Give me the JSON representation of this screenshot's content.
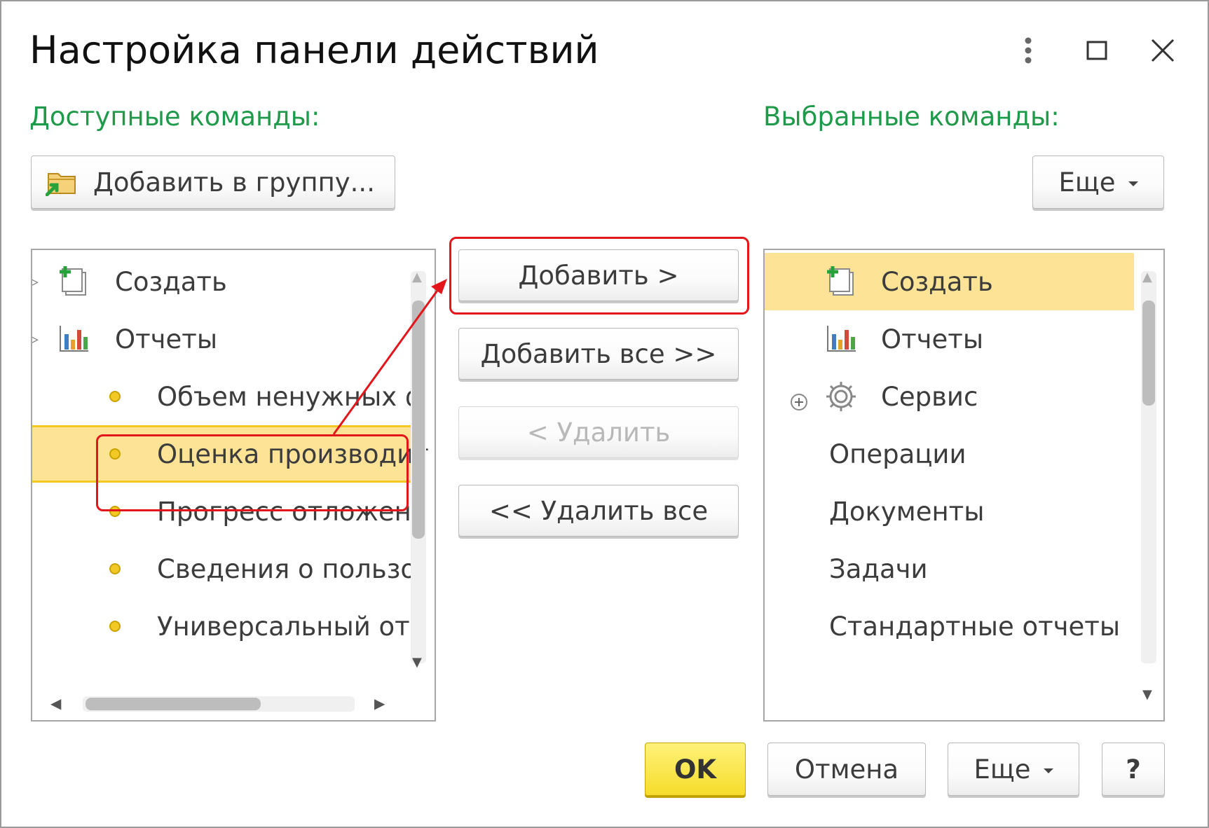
{
  "window": {
    "title": "Настройка панели действий",
    "controls": [
      "more-vertical-icon",
      "maximize-icon",
      "close-icon"
    ]
  },
  "available": {
    "label": "Доступные команды:",
    "add_to_group_button": "Добавить в группу...",
    "items": [
      {
        "label": "Создать",
        "type": "group",
        "icon": "create-icon"
      },
      {
        "label": "Отчеты",
        "type": "group",
        "icon": "reports-icon"
      },
      {
        "label": "Объем ненужных ф",
        "type": "item"
      },
      {
        "label": "Оценка производит",
        "type": "item",
        "selected": true
      },
      {
        "label": "Прогресс отложенн",
        "type": "item"
      },
      {
        "label": "Сведения о пользо",
        "type": "item"
      },
      {
        "label": "Универсальный отч",
        "type": "item"
      }
    ]
  },
  "middle": {
    "add_button": "Добавить >",
    "add_all_button": "Добавить все >>",
    "remove_button": "< Удалить",
    "remove_all_button": "<< Удалить все"
  },
  "selected": {
    "label": "Выбранные команды:",
    "more_button": "Еще",
    "items": [
      {
        "label": "Создать",
        "icon": "create-icon",
        "selected": true
      },
      {
        "label": "Отчеты",
        "icon": "reports-icon"
      },
      {
        "label": "Сервис",
        "icon": "gear-icon",
        "expandable": true
      },
      {
        "label": "Операции"
      },
      {
        "label": "Документы"
      },
      {
        "label": "Задачи"
      },
      {
        "label": "Стандартные отчеты"
      }
    ]
  },
  "footer": {
    "ok": "OK",
    "cancel": "Отмена",
    "more": "Еще",
    "help": "?"
  },
  "colors": {
    "accent_label": "#1f9a4a",
    "selection": "#fde396",
    "highlight": "#e3161b",
    "ok_button": "#f6dc2b"
  }
}
